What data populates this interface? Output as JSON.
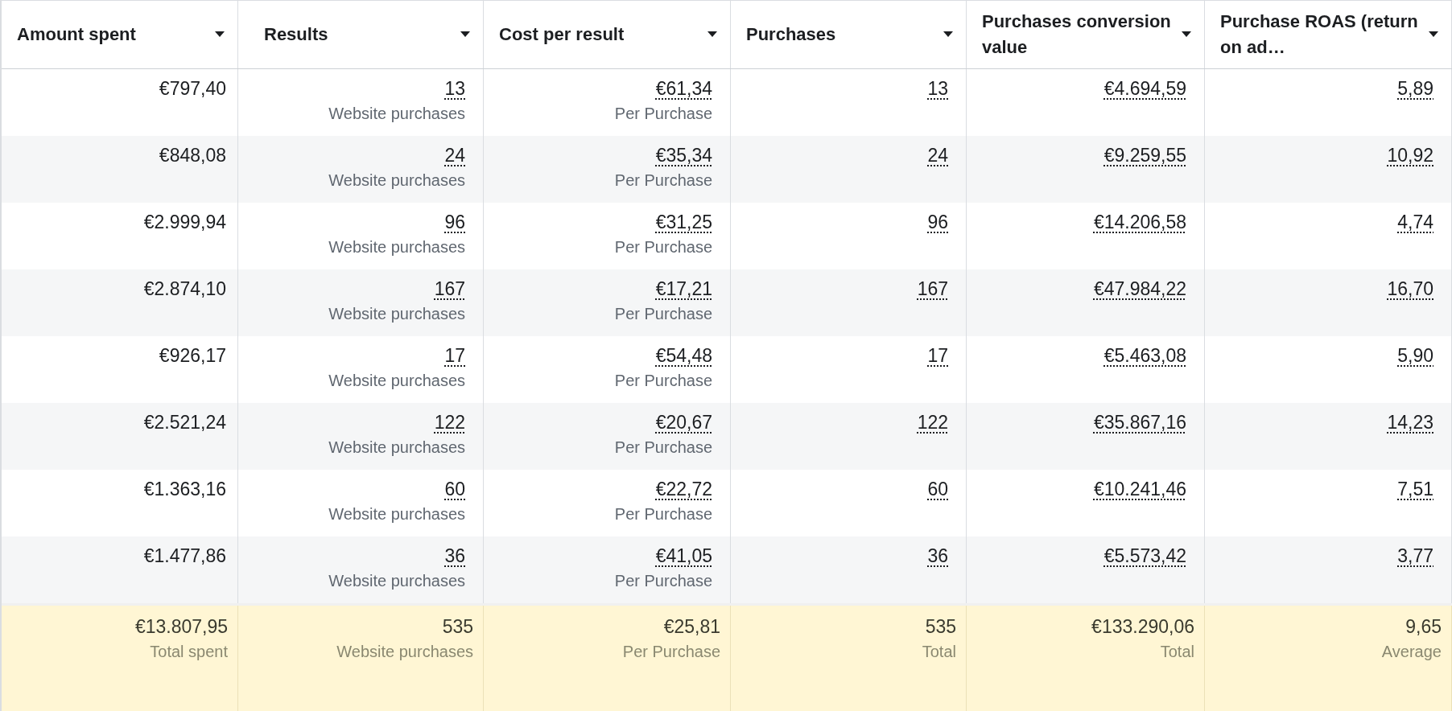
{
  "columns": [
    {
      "label": "Amount spent",
      "kind": "plain"
    },
    {
      "label": "Results",
      "kind": "metric"
    },
    {
      "label": "Cost per result",
      "kind": "metric"
    },
    {
      "label": "Purchases",
      "kind": "metric"
    },
    {
      "label": "Purchases conversion value",
      "kind": "metric"
    },
    {
      "label": "Purchase ROAS (return on ad…",
      "kind": "metric"
    }
  ],
  "rows": [
    {
      "cells": [
        {
          "value": "€797,40"
        },
        {
          "value": "13",
          "note": "Website purchases"
        },
        {
          "value": "€61,34",
          "note": "Per Purchase"
        },
        {
          "value": "13"
        },
        {
          "value": "€4.694,59"
        },
        {
          "value": "5,89"
        }
      ]
    },
    {
      "cells": [
        {
          "value": "€848,08"
        },
        {
          "value": "24",
          "note": "Website purchases"
        },
        {
          "value": "€35,34",
          "note": "Per Purchase"
        },
        {
          "value": "24"
        },
        {
          "value": "€9.259,55"
        },
        {
          "value": "10,92"
        }
      ]
    },
    {
      "cells": [
        {
          "value": "€2.999,94"
        },
        {
          "value": "96",
          "note": "Website purchases"
        },
        {
          "value": "€31,25",
          "note": "Per Purchase"
        },
        {
          "value": "96"
        },
        {
          "value": "€14.206,58"
        },
        {
          "value": "4,74"
        }
      ]
    },
    {
      "cells": [
        {
          "value": "€2.874,10"
        },
        {
          "value": "167",
          "note": "Website purchases"
        },
        {
          "value": "€17,21",
          "note": "Per Purchase"
        },
        {
          "value": "167"
        },
        {
          "value": "€47.984,22"
        },
        {
          "value": "16,70"
        }
      ]
    },
    {
      "cells": [
        {
          "value": "€926,17"
        },
        {
          "value": "17",
          "note": "Website purchases"
        },
        {
          "value": "€54,48",
          "note": "Per Purchase"
        },
        {
          "value": "17"
        },
        {
          "value": "€5.463,08"
        },
        {
          "value": "5,90"
        }
      ]
    },
    {
      "cells": [
        {
          "value": "€2.521,24"
        },
        {
          "value": "122",
          "note": "Website purchases"
        },
        {
          "value": "€20,67",
          "note": "Per Purchase"
        },
        {
          "value": "122"
        },
        {
          "value": "€35.867,16"
        },
        {
          "value": "14,23"
        }
      ]
    },
    {
      "cells": [
        {
          "value": "€1.363,16"
        },
        {
          "value": "60",
          "note": "Website purchases"
        },
        {
          "value": "€22,72",
          "note": "Per Purchase"
        },
        {
          "value": "60"
        },
        {
          "value": "€10.241,46"
        },
        {
          "value": "7,51"
        }
      ]
    },
    {
      "cells": [
        {
          "value": "€1.477,86"
        },
        {
          "value": "36",
          "note": "Website purchases"
        },
        {
          "value": "€41,05",
          "note": "Per Purchase"
        },
        {
          "value": "36"
        },
        {
          "value": "€5.573,42"
        },
        {
          "value": "3,77"
        }
      ]
    }
  ],
  "totals": [
    {
      "value": "€13.807,95",
      "note": "Total spent"
    },
    {
      "value": "535",
      "note": "Website purchases"
    },
    {
      "value": "€25,81",
      "note": "Per Purchase"
    },
    {
      "value": "535",
      "note": "Total"
    },
    {
      "value": "€133.290,06",
      "note": "Total"
    },
    {
      "value": "9,65",
      "note": "Average"
    }
  ]
}
